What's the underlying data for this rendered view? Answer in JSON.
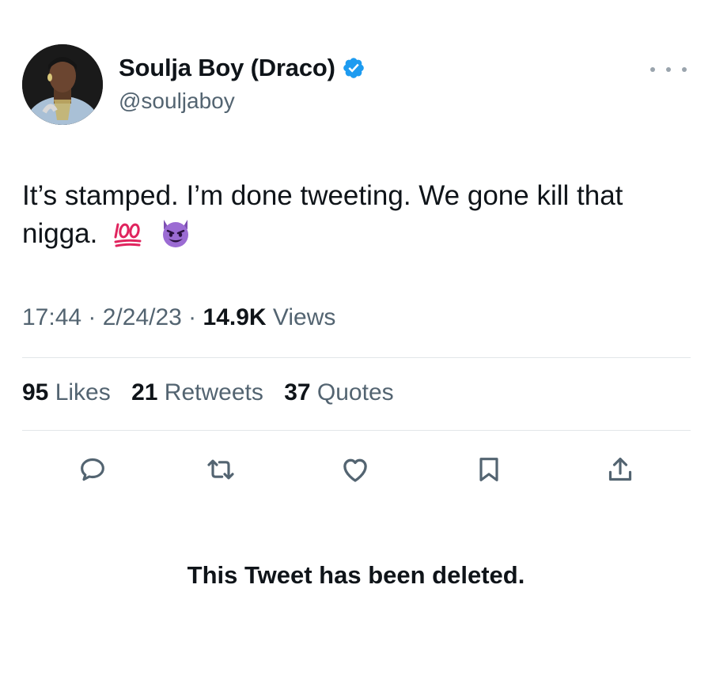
{
  "author": {
    "display_name": "Soulja Boy (Draco)",
    "handle": "@souljaboy",
    "verified_color": "#1d9bf0"
  },
  "tweet": {
    "text": "It’s stamped. I’m done tweeting. We gone kill that nigga.",
    "emojis": [
      "hundred-points-icon",
      "smiling-face-with-horns-icon"
    ]
  },
  "meta": {
    "time": "17:44",
    "sep1": " · ",
    "date": "2/24/23",
    "sep2": " · ",
    "views_count": "14.9K",
    "views_label": " Views"
  },
  "stats": {
    "likes_count": "95",
    "likes_label": " Likes",
    "retweets_count": "21",
    "retweets_label": " Retweets",
    "quotes_count": "37",
    "quotes_label": " Quotes"
  },
  "actions": [
    "reply-icon",
    "retweet-icon",
    "like-icon",
    "bookmark-icon",
    "share-icon"
  ],
  "notice": "This Tweet has been deleted.",
  "colors": {
    "text": "#0f1419",
    "secondary": "#536471",
    "divider": "#e2e6e9",
    "icon": "#536471"
  }
}
